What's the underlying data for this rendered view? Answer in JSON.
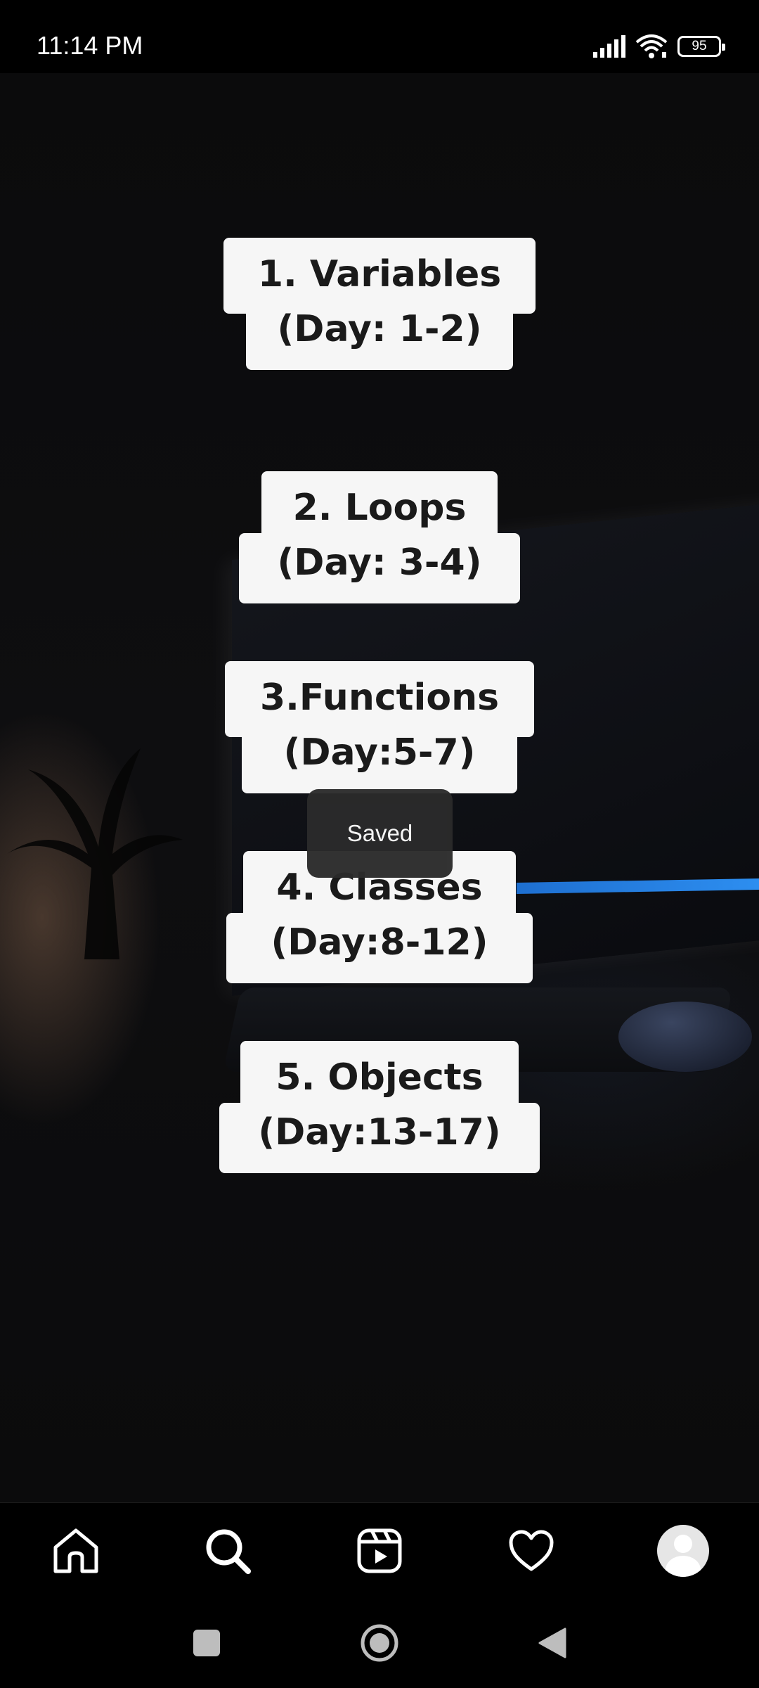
{
  "status_bar": {
    "time": "11:14 PM",
    "battery": "95",
    "icons": [
      "signal-icon",
      "wifi-icon",
      "battery-icon"
    ]
  },
  "cards": [
    {
      "line1": "1. Variables",
      "line2": "(Day: 1-2)"
    },
    {
      "line1": "2. Loops",
      "line2": "(Day: 3-4)"
    },
    {
      "line1": "3.Functions",
      "line2": "(Day:5-7)"
    },
    {
      "line1": "4. Classes",
      "line2": "(Day:8-12)"
    },
    {
      "line1": "5. Objects",
      "line2": "(Day:13-17)"
    }
  ],
  "toast": {
    "text": "Saved"
  },
  "bottom_nav": {
    "items": [
      "home-icon",
      "search-icon",
      "reels-icon",
      "heart-icon",
      "profile-avatar"
    ]
  },
  "system_nav": {
    "items": [
      "recents-button",
      "home-button",
      "back-button"
    ]
  },
  "colors": {
    "card_bg": "#f6f6f6",
    "card_text": "#1a1a1a",
    "toast_bg": "#2b2b2b"
  }
}
